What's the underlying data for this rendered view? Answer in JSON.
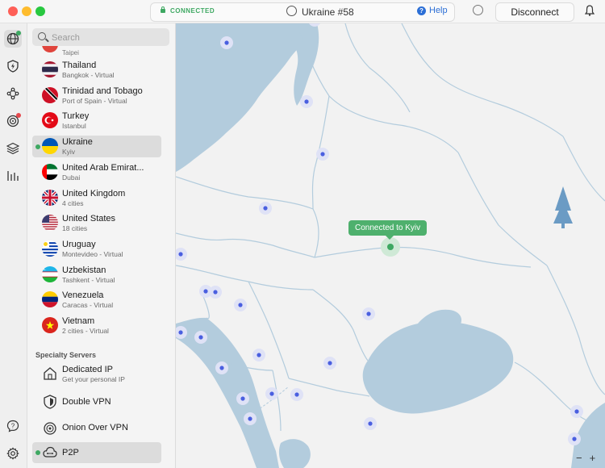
{
  "titlebar": {
    "status": "CONNECTED",
    "server": "Ukraine #58",
    "help": "Help",
    "disconnect": "Disconnect"
  },
  "search": {
    "placeholder": "Search"
  },
  "partial_item": {
    "sub": "Taipei"
  },
  "countries": [
    {
      "name": "Thailand",
      "sub": "Bangkok - Virtual",
      "flag": "thailand"
    },
    {
      "name": "Trinidad and Tobago",
      "sub": "Port of Spain - Virtual",
      "flag": "trinidad"
    },
    {
      "name": "Turkey",
      "sub": "Istanbul",
      "flag": "turkey"
    },
    {
      "name": "Ukraine",
      "sub": "Kyiv",
      "flag": "ukraine",
      "selected": true,
      "connected": true
    },
    {
      "name": "United Arab Emirat...",
      "sub": "Dubai",
      "flag": "uae"
    },
    {
      "name": "United Kingdom",
      "sub": "4 cities",
      "flag": "uk"
    },
    {
      "name": "United States",
      "sub": "18 cities",
      "flag": "usa"
    },
    {
      "name": "Uruguay",
      "sub": "Montevideo - Virtual",
      "flag": "uruguay"
    },
    {
      "name": "Uzbekistan",
      "sub": "Tashkent - Virtual",
      "flag": "uzbekistan"
    },
    {
      "name": "Venezuela",
      "sub": "Caracas - Virtual",
      "flag": "venezuela"
    },
    {
      "name": "Vietnam",
      "sub": "2 cities - Virtual",
      "flag": "vietnam"
    }
  ],
  "specialty": {
    "heading": "Specialty Servers",
    "items": [
      {
        "name": "Dedicated IP",
        "sub": "Get your personal IP",
        "icon": "house-icon"
      },
      {
        "name": "Double VPN",
        "sub": "",
        "icon": "double-vpn-icon"
      },
      {
        "name": "Onion Over VPN",
        "sub": "",
        "icon": "onion-icon"
      },
      {
        "name": "P2P",
        "sub": "",
        "icon": "p2p-icon",
        "selected": true,
        "connected": true
      }
    ]
  },
  "map": {
    "tooltip": "Connected to Kyiv",
    "zoom_out": "−",
    "zoom_in": "+"
  },
  "colors": {
    "accent_green": "#3ea862",
    "water": "#b3ccdd",
    "server_dot": "#4a5fe0",
    "help_blue": "#2c6fd6"
  }
}
